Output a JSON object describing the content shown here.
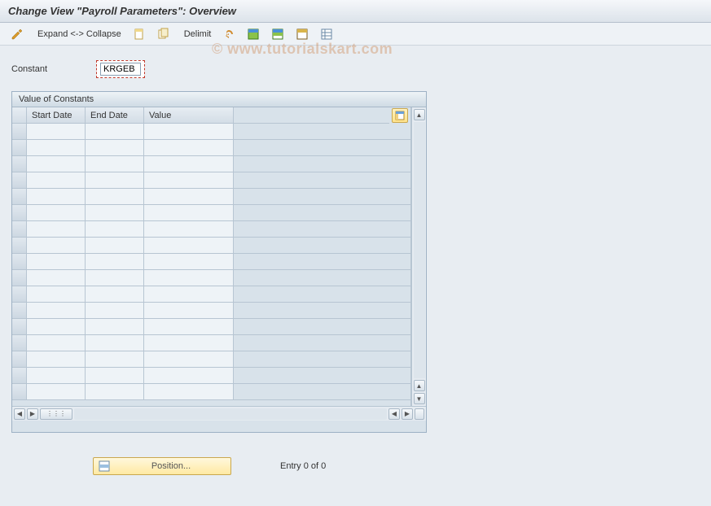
{
  "title": "Change View \"Payroll Parameters\": Overview",
  "toolbar": {
    "expand_label": "Expand <-> Collapse",
    "delimit_label": "Delimit"
  },
  "field": {
    "label": "Constant",
    "value": "KRGEB"
  },
  "panel": {
    "title": "Value of Constants",
    "columns": {
      "start": "Start Date",
      "end": "End Date",
      "value": "Value"
    },
    "rows": [
      {
        "start": "",
        "end": "",
        "value": ""
      },
      {
        "start": "",
        "end": "",
        "value": ""
      },
      {
        "start": "",
        "end": "",
        "value": ""
      },
      {
        "start": "",
        "end": "",
        "value": ""
      },
      {
        "start": "",
        "end": "",
        "value": ""
      },
      {
        "start": "",
        "end": "",
        "value": ""
      },
      {
        "start": "",
        "end": "",
        "value": ""
      },
      {
        "start": "",
        "end": "",
        "value": ""
      },
      {
        "start": "",
        "end": "",
        "value": ""
      },
      {
        "start": "",
        "end": "",
        "value": ""
      },
      {
        "start": "",
        "end": "",
        "value": ""
      },
      {
        "start": "",
        "end": "",
        "value": ""
      },
      {
        "start": "",
        "end": "",
        "value": ""
      },
      {
        "start": "",
        "end": "",
        "value": ""
      },
      {
        "start": "",
        "end": "",
        "value": ""
      },
      {
        "start": "",
        "end": "",
        "value": ""
      },
      {
        "start": "",
        "end": "",
        "value": ""
      }
    ]
  },
  "footer": {
    "position_label": "Position...",
    "entry_text": "Entry 0 of 0"
  },
  "watermark": "© www.tutorialskart.com"
}
